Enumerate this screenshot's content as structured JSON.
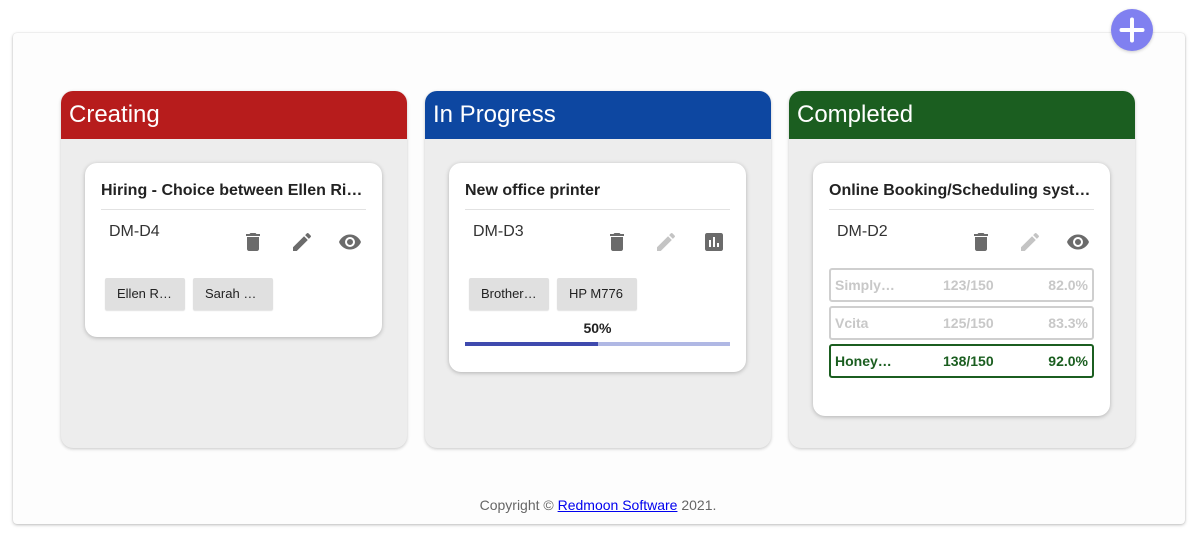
{
  "add_button": {
    "icon": "plus-icon"
  },
  "columns": [
    {
      "title": "Creating",
      "color": "#b71c1c",
      "card": {
        "title": "Hiring - Choice between Ellen Ripley and Sarah Connor",
        "code": "DM-D4",
        "options": [
          "Ellen Ripley",
          "Sarah Connor"
        ]
      }
    },
    {
      "title": "In Progress",
      "color": "#0d47a1",
      "card": {
        "title": "New office printer",
        "code": "DM-D3",
        "options": [
          "Brother HL",
          "HP M776"
        ],
        "progress_label": "50%",
        "progress": 0.5
      }
    },
    {
      "title": "Completed",
      "color": "#1b5e20",
      "card": {
        "title": "Online Booking/Scheduling system",
        "code": "DM-D2",
        "results": [
          {
            "name": "SimplyBook",
            "votes": "123/150",
            "pct": "82.0%"
          },
          {
            "name": "Vcita",
            "votes": "125/150",
            "pct": "83.3%"
          },
          {
            "name": "HoneyBook",
            "votes": "138/150",
            "pct": "92.0%"
          }
        ]
      }
    }
  ],
  "footer": {
    "prefix": "Copyright ©",
    "link": "Redmoon Software",
    "suffix": "2021."
  }
}
